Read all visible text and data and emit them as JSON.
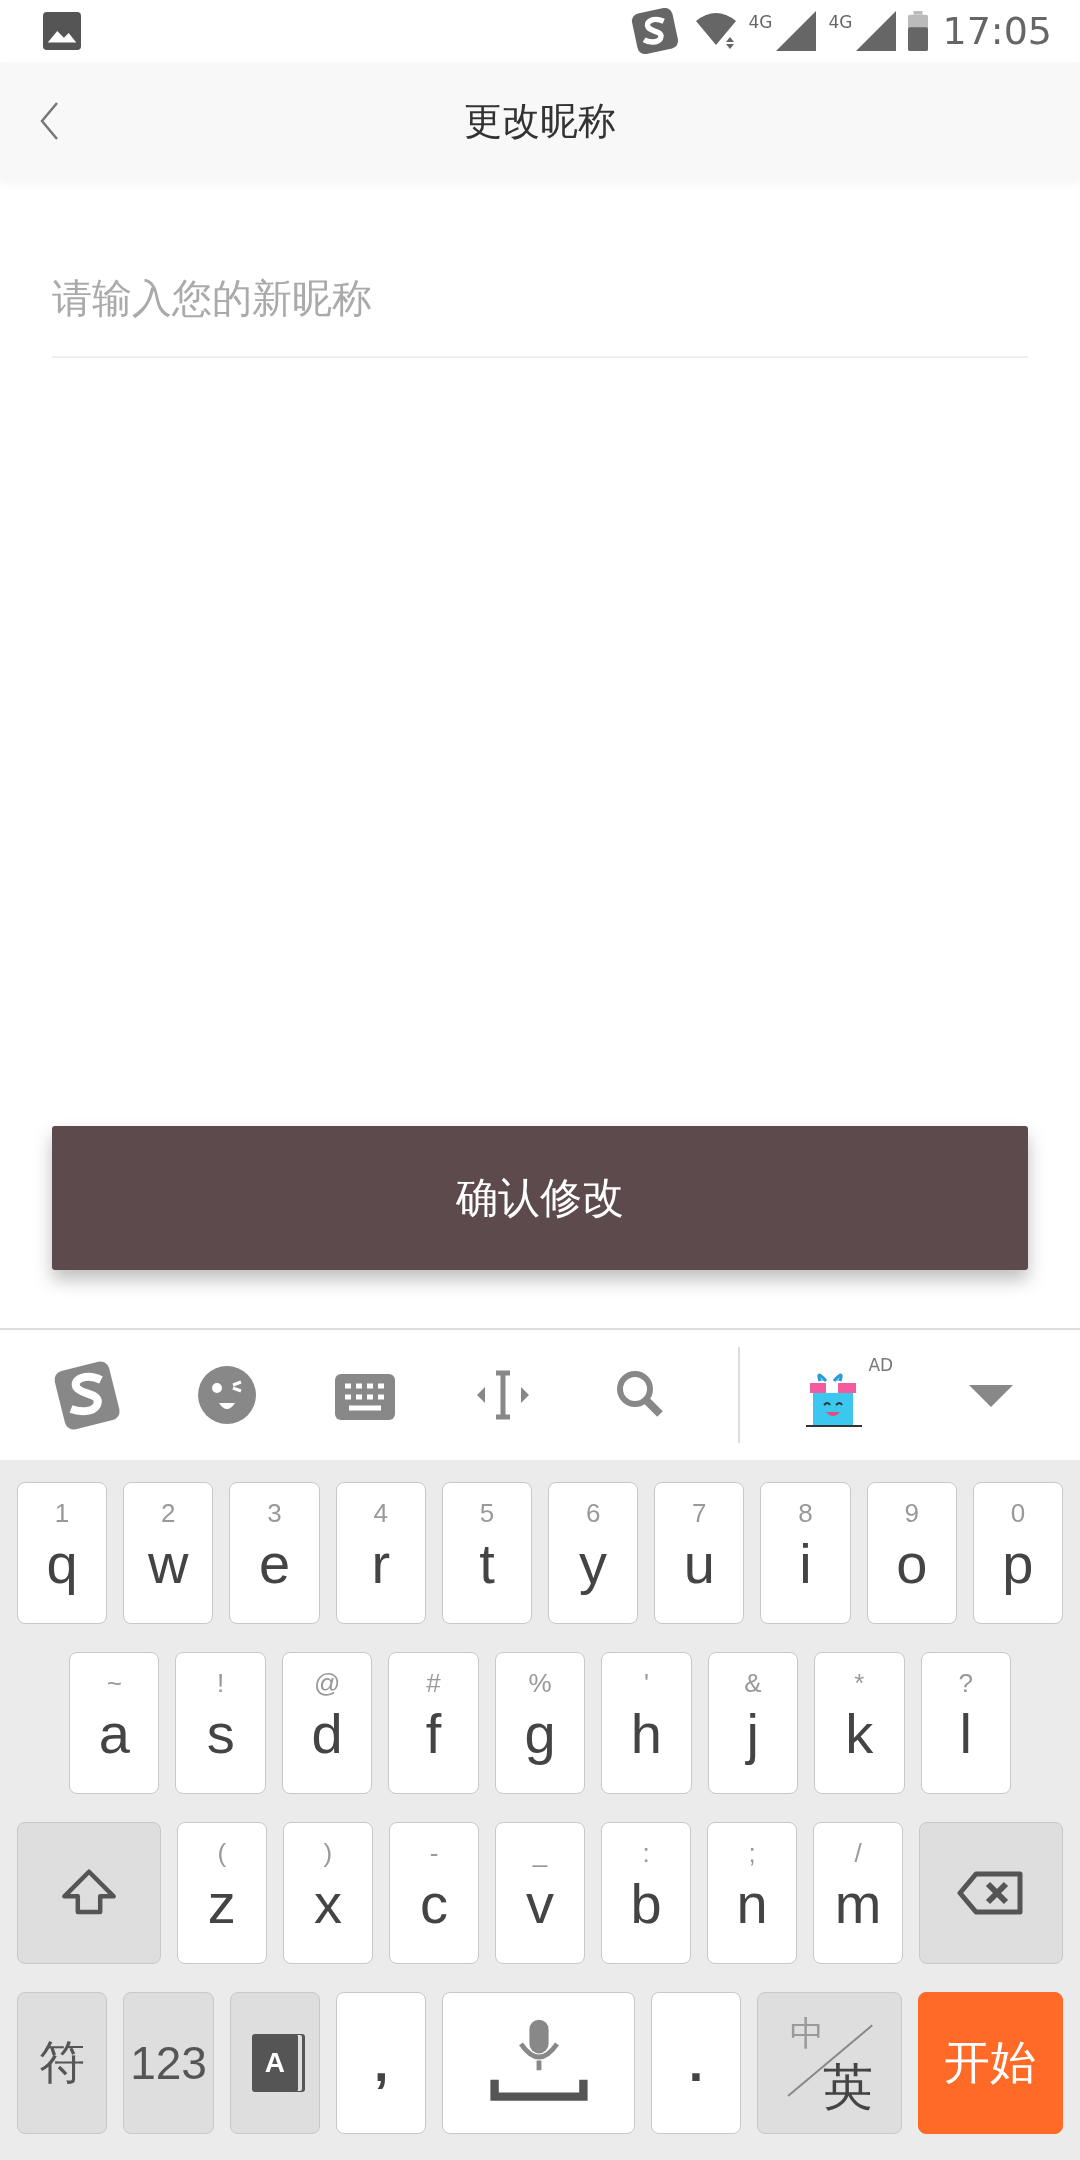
{
  "status_bar": {
    "network_1": "4G",
    "network_2": "4G",
    "time": "17:05"
  },
  "header": {
    "title": "更改昵称"
  },
  "nickname_field": {
    "placeholder": "请输入您的新昵称"
  },
  "confirm_button": "确认修改",
  "keyboard_toolbar": {
    "ad_badge": "AD"
  },
  "keyboard_rows": [
    [
      {
        "kind": "letter",
        "label": "q",
        "hint": "1"
      },
      {
        "kind": "letter",
        "label": "w",
        "hint": "2"
      },
      {
        "kind": "letter",
        "label": "e",
        "hint": "3"
      },
      {
        "kind": "letter",
        "label": "r",
        "hint": "4"
      },
      {
        "kind": "letter",
        "label": "t",
        "hint": "5"
      },
      {
        "kind": "letter",
        "label": "y",
        "hint": "6"
      },
      {
        "kind": "letter",
        "label": "u",
        "hint": "7"
      },
      {
        "kind": "letter",
        "label": "i",
        "hint": "8"
      },
      {
        "kind": "letter",
        "label": "o",
        "hint": "9"
      },
      {
        "kind": "letter",
        "label": "p",
        "hint": "0"
      }
    ],
    [
      {
        "kind": "letter",
        "label": "a",
        "hint": "~"
      },
      {
        "kind": "letter",
        "label": "s",
        "hint": "!"
      },
      {
        "kind": "letter",
        "label": "d",
        "hint": "@"
      },
      {
        "kind": "letter",
        "label": "f",
        "hint": "#"
      },
      {
        "kind": "letter",
        "label": "g",
        "hint": "%"
      },
      {
        "kind": "letter",
        "label": "h",
        "hint": "'"
      },
      {
        "kind": "letter",
        "label": "j",
        "hint": "&"
      },
      {
        "kind": "letter",
        "label": "k",
        "hint": "*"
      },
      {
        "kind": "letter",
        "label": "l",
        "hint": "?"
      }
    ],
    [
      {
        "kind": "shift"
      },
      {
        "kind": "letter",
        "label": "z",
        "hint": "("
      },
      {
        "kind": "letter",
        "label": "x",
        "hint": ")"
      },
      {
        "kind": "letter",
        "label": "c",
        "hint": "-"
      },
      {
        "kind": "letter",
        "label": "v",
        "hint": "_"
      },
      {
        "kind": "letter",
        "label": "b",
        "hint": ":"
      },
      {
        "kind": "letter",
        "label": "n",
        "hint": ";"
      },
      {
        "kind": "letter",
        "label": "m",
        "hint": "/"
      },
      {
        "kind": "delete"
      }
    ],
    [
      {
        "kind": "function",
        "label": "符"
      },
      {
        "kind": "function",
        "label": "123"
      },
      {
        "kind": "dictionary",
        "label": "A"
      },
      {
        "kind": "punct",
        "label": ","
      },
      {
        "kind": "space"
      },
      {
        "kind": "punct",
        "label": "."
      },
      {
        "kind": "lang",
        "label": "英",
        "hint": "中"
      },
      {
        "kind": "enter",
        "label": "开始"
      }
    ]
  ]
}
